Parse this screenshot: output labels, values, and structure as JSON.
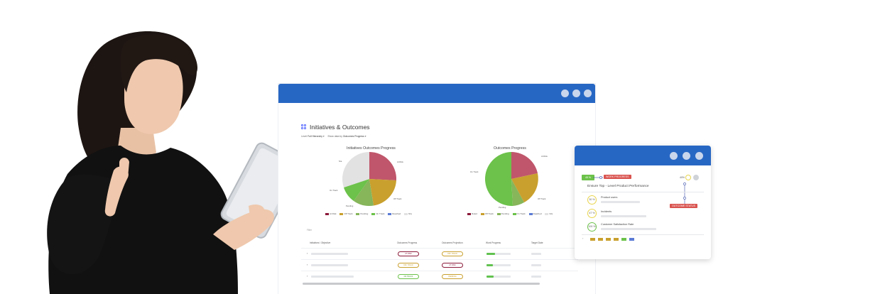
{
  "main_window": {
    "page_title": "Initiatives & Outcomes",
    "filters": {
      "level_label": "Level",
      "level_value": "Full Hierarchy",
      "show_label": "Show data by",
      "show_value": "Outcomes Progress"
    },
    "charts": [
      {
        "title": "Initiatives Outcomes Progress",
        "slice_labels": [
          "At Risk",
          "Off Track",
          "Pending",
          "On Track",
          "N/a"
        ],
        "legend": [
          "At Risk",
          "Off Track",
          "Pending",
          "On Track",
          "Reached",
          "N/a"
        ]
      },
      {
        "title": "Outcomes Progress",
        "slice_labels": [
          "At Risk",
          "Off Track",
          "Pending",
          "On Track"
        ],
        "legend": [
          "Ruled",
          "Off Track",
          "Pending",
          "On Track",
          "Reached",
          "N/a"
        ]
      }
    ],
    "table": {
      "filter_text": "Filter",
      "headers": [
        "Initiatives / Objective",
        "Outcomes Progress",
        "Outcomes Projection",
        "Work Progress",
        "Target Date"
      ],
      "rows": [
        {
          "progress": "AT RISK",
          "projection": "OFF TRACK"
        },
        {
          "progress": "OFF TRACK",
          "projection": "AT RISK"
        },
        {
          "progress": "ON TRACK",
          "projection": "PENDING"
        }
      ]
    }
  },
  "card": {
    "score": "45 %",
    "work_progress_badge": "WORK PROGRESS",
    "objective_title": "Ensure Top - Level Product Performance",
    "overall_percent": "40%",
    "outcome_status_badge": "OUTCOME STATUS",
    "key_results": [
      {
        "percent": "30 %",
        "title": "Product users"
      },
      {
        "percent": "47 %",
        "title": "Incidents"
      },
      {
        "percent": "100 %",
        "title": "Customer Satisfaction Rate"
      }
    ]
  },
  "colors": {
    "window_bar": "#2767c4",
    "at_risk": "#c0566b",
    "off_track": "#c9a02e",
    "pending": "#86b55a",
    "on_track": "#6cc24a",
    "na": "#e2e2e2",
    "reached": "#5b7bd5"
  }
}
